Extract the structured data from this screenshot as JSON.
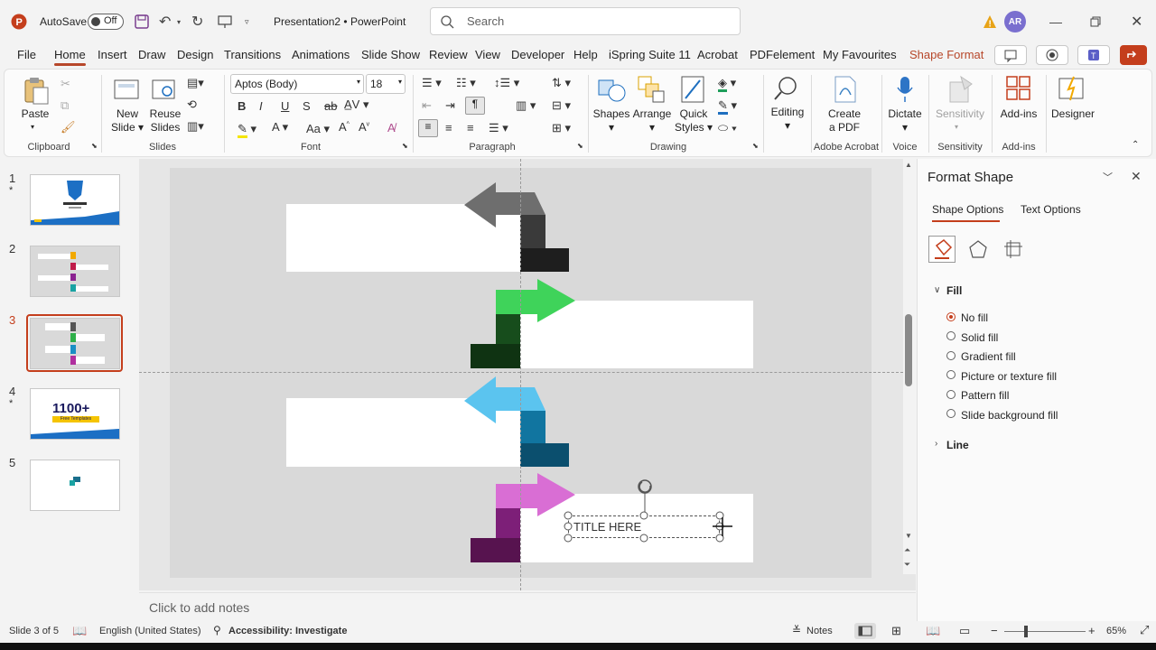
{
  "titlebar": {
    "autosave_label": "AutoSave",
    "autosave_state": "Off",
    "doc_title": "Presentation2",
    "separator": "•",
    "app_name": "PowerPoint",
    "search_placeholder": "Search",
    "avatar_initials": "AR"
  },
  "menu": {
    "tabs": [
      "File",
      "Home",
      "Insert",
      "Draw",
      "Design",
      "Transitions",
      "Animations",
      "Slide Show",
      "Review",
      "View",
      "Developer",
      "Help",
      "iSpring Suite 11",
      "Acrobat",
      "PDFelement",
      "My Favourites",
      "Shape Format"
    ],
    "active": "Home"
  },
  "ribbon": {
    "clipboard": {
      "paste": "Paste",
      "label": "Clipboard"
    },
    "slides": {
      "new_slide_1": "New",
      "new_slide_2": "Slide",
      "reuse_1": "Reuse",
      "reuse_2": "Slides",
      "label": "Slides"
    },
    "font": {
      "font_name": "Aptos (Body)",
      "font_size": "18",
      "label": "Font"
    },
    "paragraph": {
      "label": "Paragraph"
    },
    "drawing": {
      "shapes": "Shapes",
      "arrange": "Arrange",
      "quick_styles_1": "Quick",
      "quick_styles_2": "Styles",
      "label": "Drawing"
    },
    "editing": {
      "label": "Editing"
    },
    "adobe": {
      "create_pdf_1": "Create",
      "create_pdf_2": "a PDF",
      "label": "Adobe Acrobat"
    },
    "voice": {
      "dictate": "Dictate",
      "label": "Voice"
    },
    "sensitivity": {
      "button": "Sensitivity",
      "label": "Sensitivity"
    },
    "addins": {
      "button": "Add-ins",
      "label": "Add-ins"
    },
    "designer": {
      "button": "Designer"
    }
  },
  "thumbnails": [
    {
      "num": "1",
      "star": "*"
    },
    {
      "num": "2",
      "star": ""
    },
    {
      "num": "3",
      "star": ""
    },
    {
      "num": "4",
      "star": "*"
    },
    {
      "num": "5",
      "star": ""
    }
  ],
  "thumb4_text": "1100+",
  "thumb4_sub": "Free Templates",
  "slide": {
    "textbox_text": "TITLE HERE"
  },
  "colors": {
    "gray_arrow": "#6e6e6e",
    "gray_dark": "#3a3a3a",
    "gray_darkest": "#1e1e1e",
    "green_arrow": "#3fd35a",
    "green_dark": "#174d1c",
    "green_darkest": "#0f3312",
    "blue_arrow": "#5bc4ef",
    "blue_dark": "#1175a0",
    "blue_darkest": "#0b4f6e",
    "pink_arrow": "#d96ed4",
    "pink_dark": "#7d1f78",
    "pink_darkest": "#57134f",
    "accent": "#b7472a"
  },
  "notes": {
    "placeholder": "Click to add notes"
  },
  "status": {
    "slide_of": "Slide 3 of 5",
    "language": "English (United States)",
    "accessibility": "Accessibility: Investigate",
    "notes_btn": "Notes",
    "zoom": "65%"
  },
  "pane": {
    "title": "Format Shape",
    "tab_shape": "Shape Options",
    "tab_text": "Text Options",
    "fill_header": "Fill",
    "fill_options": [
      "No fill",
      "Solid fill",
      "Gradient fill",
      "Picture or texture fill",
      "Pattern fill",
      "Slide background fill"
    ],
    "line_header": "Line"
  }
}
